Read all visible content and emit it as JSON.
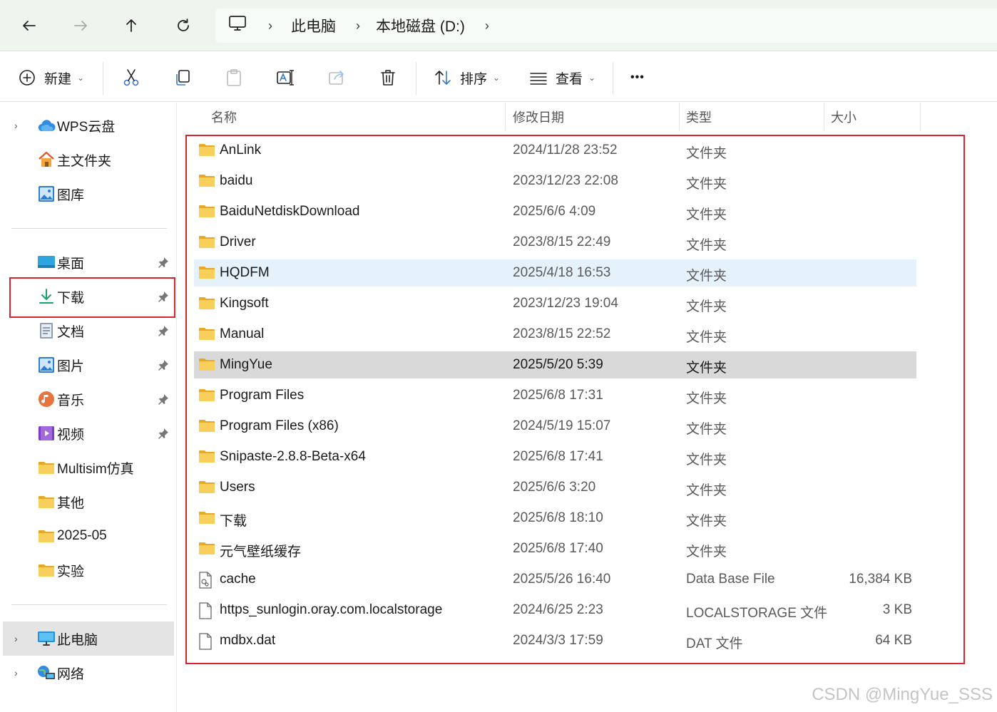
{
  "address": {
    "crumbs": [
      "此电脑",
      "本地磁盘 (D:)"
    ]
  },
  "toolbar": {
    "new_label": "新建",
    "sort_label": "排序",
    "view_label": "查看",
    "more_label": "•••"
  },
  "sidebar": {
    "top": [
      {
        "label": "WPS云盘",
        "icon": "cloud-icon",
        "expandable": true
      },
      {
        "label": "主文件夹",
        "icon": "home-icon"
      },
      {
        "label": "图库",
        "icon": "gallery-icon"
      }
    ],
    "quick": [
      {
        "label": "桌面",
        "icon": "desktop-icon",
        "pinned": true
      },
      {
        "label": "下载",
        "icon": "download-icon",
        "pinned": true
      },
      {
        "label": "文档",
        "icon": "document-icon",
        "pinned": true
      },
      {
        "label": "图片",
        "icon": "pictures-icon",
        "pinned": true
      },
      {
        "label": "音乐",
        "icon": "music-icon",
        "pinned": true
      },
      {
        "label": "视频",
        "icon": "video-icon",
        "pinned": true
      },
      {
        "label": "Multisim仿真",
        "icon": "folder-icon"
      },
      {
        "label": "其他",
        "icon": "folder-icon"
      },
      {
        "label": "2025-05",
        "icon": "folder-icon"
      },
      {
        "label": "实验",
        "icon": "folder-icon"
      }
    ],
    "bottom": [
      {
        "label": "此电脑",
        "icon": "this-pc-icon",
        "expandable": true,
        "selected": true
      },
      {
        "label": "网络",
        "icon": "network-icon",
        "expandable": true
      }
    ]
  },
  "columns": [
    "名称",
    "修改日期",
    "类型",
    "大小"
  ],
  "files": [
    {
      "name": "AnLink",
      "date": "2024/11/28 23:52",
      "type": "文件夹",
      "size": "",
      "kind": "folder"
    },
    {
      "name": "baidu",
      "date": "2023/12/23 22:08",
      "type": "文件夹",
      "size": "",
      "kind": "folder"
    },
    {
      "name": "BaiduNetdiskDownload",
      "date": "2025/6/6 4:09",
      "type": "文件夹",
      "size": "",
      "kind": "folder"
    },
    {
      "name": "Driver",
      "date": "2023/8/15 22:49",
      "type": "文件夹",
      "size": "",
      "kind": "folder"
    },
    {
      "name": "HQDFM",
      "date": "2025/4/18 16:53",
      "type": "文件夹",
      "size": "",
      "kind": "folder",
      "state": "hover"
    },
    {
      "name": "Kingsoft",
      "date": "2023/12/23 19:04",
      "type": "文件夹",
      "size": "",
      "kind": "folder"
    },
    {
      "name": "Manual",
      "date": "2023/8/15 22:52",
      "type": "文件夹",
      "size": "",
      "kind": "folder"
    },
    {
      "name": "MingYue",
      "date": "2025/5/20 5:39",
      "type": "文件夹",
      "size": "",
      "kind": "folder",
      "state": "selected"
    },
    {
      "name": "Program Files",
      "date": "2025/6/8 17:31",
      "type": "文件夹",
      "size": "",
      "kind": "folder"
    },
    {
      "name": "Program Files (x86)",
      "date": "2024/5/19 15:07",
      "type": "文件夹",
      "size": "",
      "kind": "folder"
    },
    {
      "name": "Snipaste-2.8.8-Beta-x64",
      "date": "2025/6/8 17:41",
      "type": "文件夹",
      "size": "",
      "kind": "folder"
    },
    {
      "name": "Users",
      "date": "2025/6/6 3:20",
      "type": "文件夹",
      "size": "",
      "kind": "folder"
    },
    {
      "name": "下载",
      "date": "2025/6/8 18:10",
      "type": "文件夹",
      "size": "",
      "kind": "folder"
    },
    {
      "name": "元气壁纸缓存",
      "date": "2025/6/8 17:40",
      "type": "文件夹",
      "size": "",
      "kind": "folder"
    },
    {
      "name": "cache",
      "date": "2025/5/26 16:40",
      "type": "Data Base File",
      "size": "16,384 KB",
      "kind": "dbfile"
    },
    {
      "name": "https_sunlogin.oray.com.localstorage",
      "date": "2024/6/25 2:23",
      "type": "LOCALSTORAGE 文件",
      "size": "3 KB",
      "kind": "file"
    },
    {
      "name": "mdbx.dat",
      "date": "2024/3/3 17:59",
      "type": "DAT 文件",
      "size": "64 KB",
      "kind": "file"
    }
  ],
  "watermark": "CSDN @MingYue_SSS",
  "colors": {
    "accent_red": "#d9242f",
    "folder_yellow": "#f6c342",
    "nav_bg": "#eef5ee"
  }
}
